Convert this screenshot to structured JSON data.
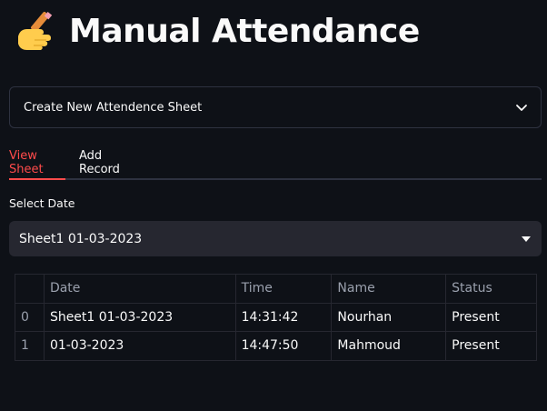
{
  "header": {
    "icon": "writing-hand-icon",
    "title": "Manual Attendance"
  },
  "expander": {
    "label": "Create New Attendence Sheet",
    "icon": "chevron-down-icon"
  },
  "tabs": [
    {
      "label": "View Sheet",
      "active": true
    },
    {
      "label": "Add Record",
      "active": false
    }
  ],
  "select": {
    "label": "Select Date",
    "value": "Sheet1 01-03-2023"
  },
  "table": {
    "columns": [
      "",
      "Date",
      "Time",
      "Name",
      "Status"
    ],
    "rows": [
      [
        "0",
        "Sheet1 01-03-2023",
        "14:31:42",
        "Nourhan",
        "Present"
      ],
      [
        "1",
        "01-03-2023",
        "14:47:50",
        "Mahmoud",
        "Present"
      ]
    ]
  },
  "colors": {
    "background": "#0e1117",
    "accent": "#ff4b4b",
    "surface": "#262730"
  }
}
